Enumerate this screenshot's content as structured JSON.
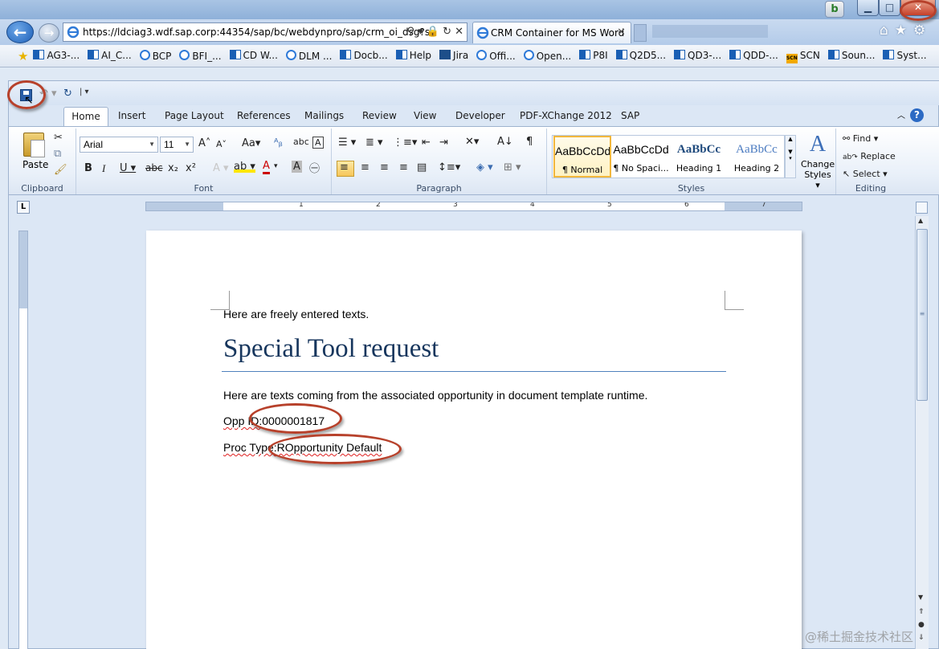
{
  "browser": {
    "address_url": "https://ldciag3.wdf.sap.corp:44354/sap/bc/webdynpro/sap/crm_oi_dsg?sa",
    "tab_title": "CRM Container for MS Word",
    "window_buttons": {
      "minimize": "▁",
      "maximize": "□",
      "close": "✕"
    },
    "favorites": [
      {
        "label": "AG3-...",
        "icon": "sap"
      },
      {
        "label": "AI_C...",
        "icon": "sap"
      },
      {
        "label": "BCP",
        "icon": "ie"
      },
      {
        "label": "BFI_...",
        "icon": "ie"
      },
      {
        "label": "CD W...",
        "icon": "sap"
      },
      {
        "label": "DLM ...",
        "icon": "ie"
      },
      {
        "label": "Docb...",
        "icon": "sap"
      },
      {
        "label": "Help",
        "icon": "sap"
      },
      {
        "label": "Jira",
        "icon": "jira"
      },
      {
        "label": "Offi...",
        "icon": "ie"
      },
      {
        "label": "Open...",
        "icon": "ie"
      },
      {
        "label": "P8I",
        "icon": "sap"
      },
      {
        "label": "Q2D5...",
        "icon": "sap"
      },
      {
        "label": "QD3-...",
        "icon": "sap"
      },
      {
        "label": "QDD-...",
        "icon": "sap"
      },
      {
        "label": "SCN",
        "icon": "scn"
      },
      {
        "label": "Soun...",
        "icon": "sap"
      },
      {
        "label": "Syst...",
        "icon": "sap"
      }
    ]
  },
  "word": {
    "ribbon_tabs": [
      "Home",
      "Insert",
      "Page Layout",
      "References",
      "Mailings",
      "Review",
      "View",
      "Developer",
      "PDF-XChange 2012",
      "SAP"
    ],
    "groups": {
      "clipboard": "Clipboard",
      "font": "Font",
      "paragraph": "Paragraph",
      "styles": "Styles",
      "editing": "Editing"
    },
    "paste_label": "Paste",
    "font_name": "Arial",
    "font_size": "11",
    "styles": [
      {
        "sample": "AaBbCcDd",
        "name": "¶ Normal"
      },
      {
        "sample": "AaBbCcDd",
        "name": "¶ No Spaci..."
      },
      {
        "sample": "AaBbCc",
        "name": "Heading 1"
      },
      {
        "sample": "AaBbCc",
        "name": "Heading 2"
      }
    ],
    "change_styles": "Change Styles",
    "editing": {
      "find": "Find",
      "replace": "Replace",
      "select": "Select"
    },
    "ruler_numbers": [
      "1",
      "2",
      "3",
      "4",
      "5",
      "6",
      "7"
    ]
  },
  "document": {
    "intro": "Here are freely entered texts.",
    "heading": "Special Tool request",
    "body": "Here are texts coming from the associated opportunity in document template runtime.",
    "opp_label": "Opp ID:",
    "opp_value": "0000001817",
    "proc_label": "Proc Type:",
    "proc_value": "ROpportunity Default"
  },
  "watermark": "@稀土掘金技术社区"
}
